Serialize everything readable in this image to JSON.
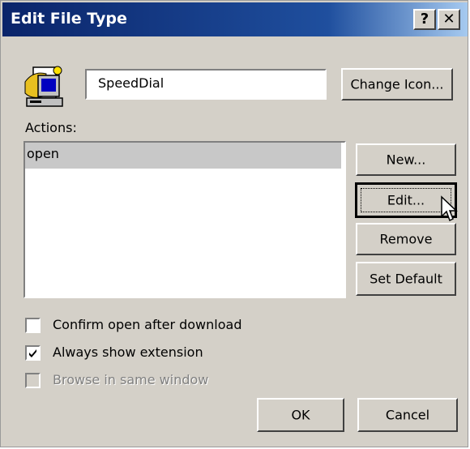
{
  "window": {
    "title": "Edit File Type",
    "help_label": "?",
    "close_label": "✕"
  },
  "file_type": {
    "description_value": "SpeedDial",
    "change_icon_label": "Change Icon..."
  },
  "actions": {
    "label": "Actions:",
    "items": [
      "open"
    ],
    "selected_index": 0,
    "new_label": "New...",
    "edit_label": "Edit...",
    "remove_label": "Remove",
    "set_default_label": "Set Default"
  },
  "options": {
    "confirm_open_label": "Confirm open after download",
    "confirm_open_checked": false,
    "always_show_ext_label": "Always show extension",
    "always_show_ext_checked": true,
    "browse_same_window_label": "Browse in same window",
    "browse_same_window_checked": false,
    "browse_same_window_enabled": false
  },
  "footer": {
    "ok_label": "OK",
    "cancel_label": "Cancel"
  }
}
